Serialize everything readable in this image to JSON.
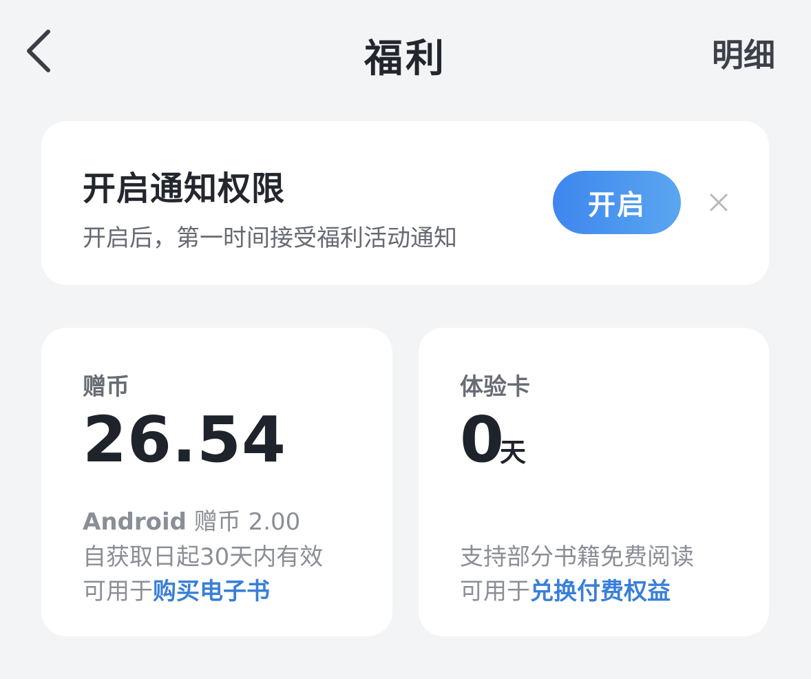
{
  "header": {
    "title": "福利",
    "detail_label": "明细"
  },
  "notification": {
    "title": "开启通知权限",
    "description": "开启后，第一时间接受福利活动通知",
    "enable_label": "开启"
  },
  "coins_card": {
    "label": "赠币",
    "value": "26.54",
    "platform": "Android",
    "platform_suffix": "赠币",
    "platform_amount": "2.00",
    "validity_prefix": "自获取日起",
    "validity_days": "30",
    "validity_suffix": "天内有效",
    "usage_prefix": "可用于",
    "usage_link": "购买电子书"
  },
  "trial_card": {
    "label": "体验卡",
    "value": "0",
    "unit": "天",
    "description": "支持部分书籍免费阅读",
    "usage_prefix": "可用于",
    "usage_link": "兑换付费权益"
  },
  "colors": {
    "background": "#f3f4f6",
    "card": "#ffffff",
    "accent": "#3e86ee",
    "link": "#3a7fd8"
  },
  "icons": [
    "back-chevron-icon",
    "close-icon"
  ]
}
